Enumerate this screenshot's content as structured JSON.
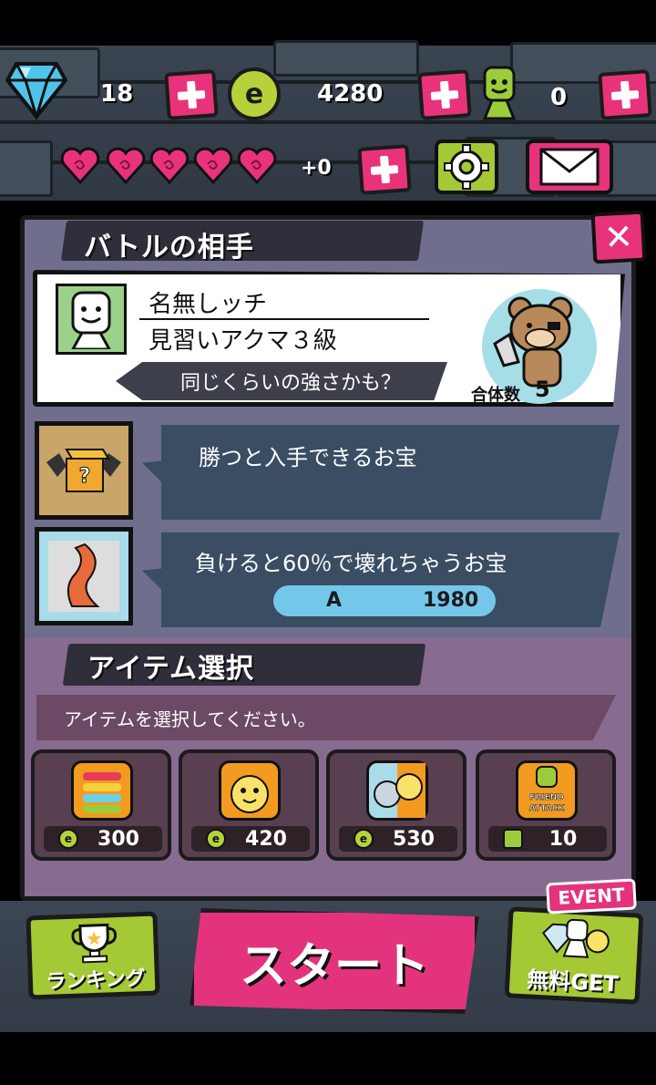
{
  "resources": {
    "diamonds": "18",
    "coins": "4280",
    "friend_points": "0",
    "heart_bonus": "+0"
  },
  "battle": {
    "title": "バトルの相手",
    "opponent_name": "名無しッチ",
    "opponent_rank": "見習いアクマ３級",
    "strength_hint": "同じくらいの強さかも？",
    "merge_label": "合体数",
    "merge_count": "5",
    "win_treasure": "勝つと入手できるお宝",
    "lose_treasure": "負けると60％で壊れちゃうお宝",
    "lose_treasure_grade": "A",
    "lose_treasure_value": "1980"
  },
  "items": {
    "title": "アイテム選択",
    "hint": "アイテムを選択してください。",
    "slots": [
      {
        "cost": "300"
      },
      {
        "cost": "420"
      },
      {
        "cost": "530"
      },
      {
        "label": "FRIEND\nATTACK",
        "cost": "10"
      }
    ]
  },
  "bottom": {
    "ranking": "ランキング",
    "start": "スタート",
    "event_tag": "EVENT",
    "free_get": "無料GET"
  },
  "colors": {
    "accent_pink": "#e8337a",
    "accent_green": "#a5c835",
    "panel": "#6f6e8c",
    "panel_lower": "#876b90"
  }
}
